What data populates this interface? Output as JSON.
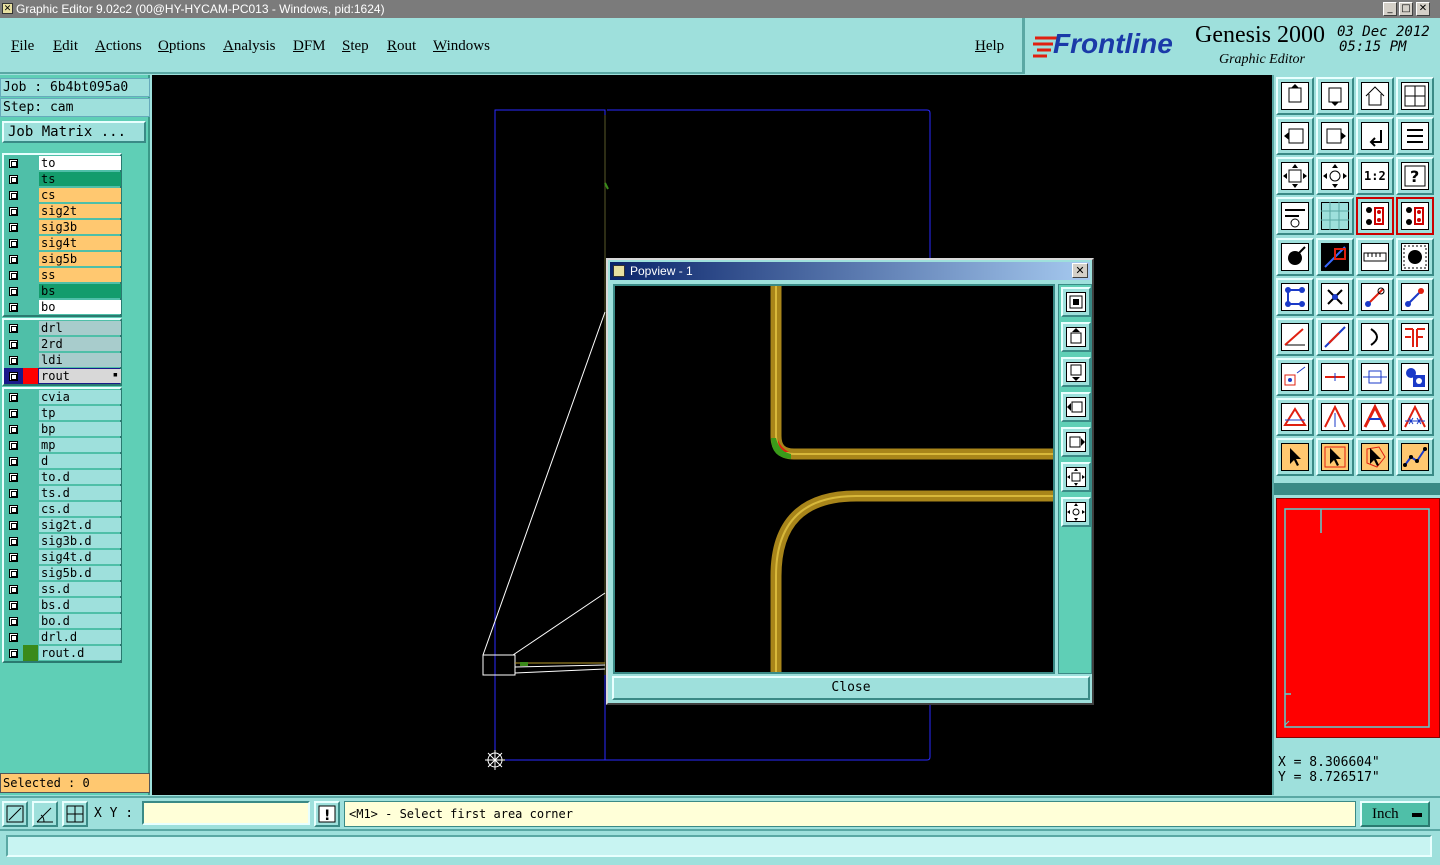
{
  "window": {
    "title": "Graphic Editor 9.02c2 (00@HY-HYCAM-PC013 - Windows, pid:1624)",
    "minimize": "_",
    "maximize": "□",
    "close": "✕"
  },
  "menu": {
    "items": [
      "File",
      "Edit",
      "Actions",
      "Options",
      "Analysis",
      "DFM",
      "Step",
      "Rout",
      "Windows"
    ],
    "help": "Help"
  },
  "brand": {
    "logo": "Frontline",
    "product": "Genesis 2000",
    "subtitle": "Graphic Editor",
    "date": "03  Dec  2012",
    "time": "05:15  PM"
  },
  "left": {
    "job": "Job  : 6b4bt095a0",
    "step": "Step: cam",
    "job_matrix": "Job Matrix ...",
    "groups": [
      [
        {
          "name": "to",
          "color": "#ffffff"
        },
        {
          "name": "ts",
          "color": "#139c6c"
        },
        {
          "name": "cs",
          "color": "#ffc870"
        },
        {
          "name": "sig2t",
          "color": "#ffc870"
        },
        {
          "name": "sig3b",
          "color": "#ffc870"
        },
        {
          "name": "sig4t",
          "color": "#ffc870"
        },
        {
          "name": "sig5b",
          "color": "#ffc870"
        },
        {
          "name": "ss",
          "color": "#ffc870"
        },
        {
          "name": "bs",
          "color": "#139c6c"
        },
        {
          "name": "bo",
          "color": "#ffffff"
        }
      ],
      [
        {
          "name": "drl",
          "color": "#a8cccc"
        },
        {
          "name": "2rd",
          "color": "#a8cccc"
        },
        {
          "name": "ldi",
          "color": "#a8cccc"
        },
        {
          "name": "rout",
          "color": "#d8d8d8",
          "active": true
        }
      ],
      [
        {
          "name": "cvia",
          "color": "#9ee0dc"
        },
        {
          "name": "tp",
          "color": "#9ee0dc"
        },
        {
          "name": "bp",
          "color": "#9ee0dc"
        },
        {
          "name": "mp",
          "color": "#9ee0dc"
        },
        {
          "name": "d",
          "color": "#9ee0dc"
        },
        {
          "name": "to.d",
          "color": "#9ee0dc"
        },
        {
          "name": "ts.d",
          "color": "#9ee0dc"
        },
        {
          "name": "cs.d",
          "color": "#9ee0dc"
        },
        {
          "name": "sig2t.d",
          "color": "#9ee0dc"
        },
        {
          "name": "sig3b.d",
          "color": "#9ee0dc"
        },
        {
          "name": "sig4t.d",
          "color": "#9ee0dc"
        },
        {
          "name": "sig5b.d",
          "color": "#9ee0dc"
        },
        {
          "name": "ss.d",
          "color": "#9ee0dc"
        },
        {
          "name": "bs.d",
          "color": "#9ee0dc"
        },
        {
          "name": "bo.d",
          "color": "#9ee0dc"
        },
        {
          "name": "drl.d",
          "color": "#9ee0dc"
        },
        {
          "name": "rout.d",
          "color": "#9ee0dc",
          "swatch": "#3a8a1a"
        }
      ]
    ],
    "selected": "Selected : 0"
  },
  "right": {
    "fit_label": "1:2",
    "coords_x": "X = 8.306604\"",
    "coords_y": "Y = 8.726517\""
  },
  "bottom": {
    "xy_label": "X Y :",
    "xy_value": "",
    "prompt": "<M1> - Select first area corner",
    "units": "Inch"
  },
  "popview": {
    "title": "Popview - 1",
    "close_label": "Close"
  }
}
